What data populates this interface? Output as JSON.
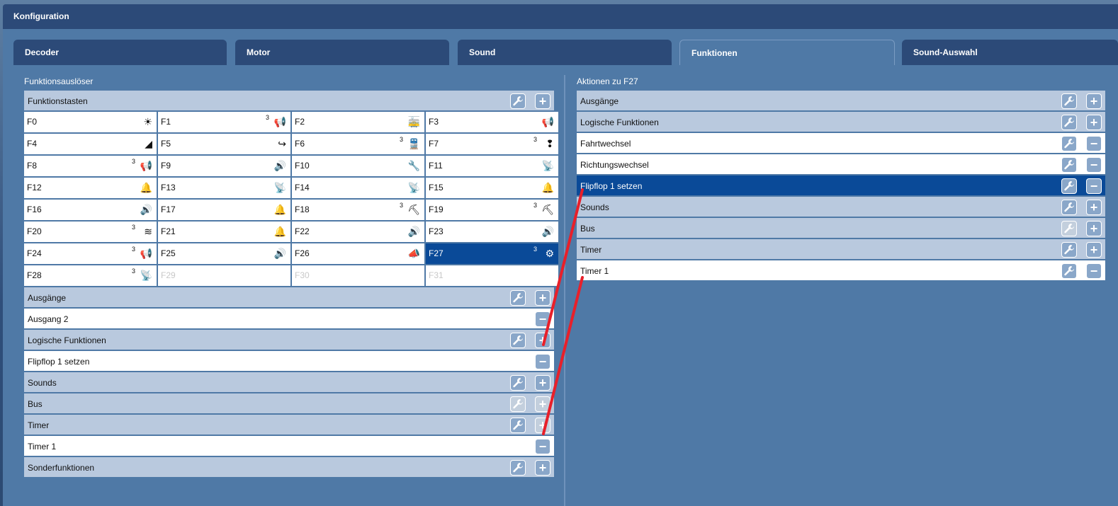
{
  "window": {
    "title": "Konfiguration"
  },
  "tabs": [
    {
      "label": "Decoder"
    },
    {
      "label": "Motor"
    },
    {
      "label": "Sound"
    },
    {
      "label": "Funktionen"
    },
    {
      "label": "Sound-Auswahl"
    }
  ],
  "left_panel": {
    "title": "Funktionsauslöser",
    "funktionstasten_label": "Funktionstasten",
    "keys": [
      {
        "label": "F0",
        "icon": "☀",
        "sup": ""
      },
      {
        "label": "F1",
        "icon": "📢",
        "sup": "3"
      },
      {
        "label": "F2",
        "icon": "🚋",
        "sup": ""
      },
      {
        "label": "F3",
        "icon": "📢",
        "sup": ""
      },
      {
        "label": "F4",
        "icon": "◢",
        "sup": ""
      },
      {
        "label": "F5",
        "icon": "↪",
        "sup": ""
      },
      {
        "label": "F6",
        "icon": "🚆",
        "sup": "3"
      },
      {
        "label": "F7",
        "icon": "❢",
        "sup": "3"
      },
      {
        "label": "F8",
        "icon": "📢",
        "sup": "3"
      },
      {
        "label": "F9",
        "icon": "🔊",
        "sup": ""
      },
      {
        "label": "F10",
        "icon": "🔧",
        "sup": ""
      },
      {
        "label": "F11",
        "icon": "📡",
        "sup": ""
      },
      {
        "label": "F12",
        "icon": "🔔",
        "sup": ""
      },
      {
        "label": "F13",
        "icon": "📡",
        "sup": ""
      },
      {
        "label": "F14",
        "icon": "📡",
        "sup": ""
      },
      {
        "label": "F15",
        "icon": "🔔",
        "sup": ""
      },
      {
        "label": "F16",
        "icon": "🔊",
        "sup": ""
      },
      {
        "label": "F17",
        "icon": "🔔",
        "sup": ""
      },
      {
        "label": "F18",
        "icon": "⛏",
        "sup": "3"
      },
      {
        "label": "F19",
        "icon": "⛏",
        "sup": "3"
      },
      {
        "label": "F20",
        "icon": "≋",
        "sup": "3"
      },
      {
        "label": "F21",
        "icon": "🔔",
        "sup": ""
      },
      {
        "label": "F22",
        "icon": "🔊",
        "sup": ""
      },
      {
        "label": "F23",
        "icon": "🔊",
        "sup": ""
      },
      {
        "label": "F24",
        "icon": "📢",
        "sup": "3"
      },
      {
        "label": "F25",
        "icon": "🔊",
        "sup": ""
      },
      {
        "label": "F26",
        "icon": "📣",
        "sup": ""
      },
      {
        "label": "F27",
        "icon": "⚙",
        "sup": "3"
      },
      {
        "label": "F28",
        "icon": "📡",
        "sup": "3"
      },
      {
        "label": "F29",
        "icon": "",
        "sup": ""
      },
      {
        "label": "F30",
        "icon": "",
        "sup": ""
      },
      {
        "label": "F31",
        "icon": "",
        "sup": ""
      }
    ],
    "sections": {
      "ausgaenge": "Ausgänge",
      "ausgang2": "Ausgang 2",
      "logische": "Logische Funktionen",
      "flipflop": "Flipflop 1 setzen",
      "sounds": "Sounds",
      "bus": "Bus",
      "timer": "Timer",
      "timer1": "Timer 1",
      "sonder": "Sonderfunktionen"
    }
  },
  "right_panel": {
    "title": "Aktionen zu F27",
    "sections": {
      "ausgaenge": "Ausgänge",
      "logische": "Logische Funktionen",
      "fahrtwechsel": "Fahrtwechsel",
      "richtungswechsel": "Richtungswechsel",
      "flipflop": "Flipflop 1 setzen",
      "sounds": "Sounds",
      "bus": "Bus",
      "timer": "Timer",
      "timer1": "Timer 1"
    }
  },
  "colors": {
    "accent": "#0a4a98",
    "header": "#2c4a78",
    "annotation": "#e8202a"
  }
}
